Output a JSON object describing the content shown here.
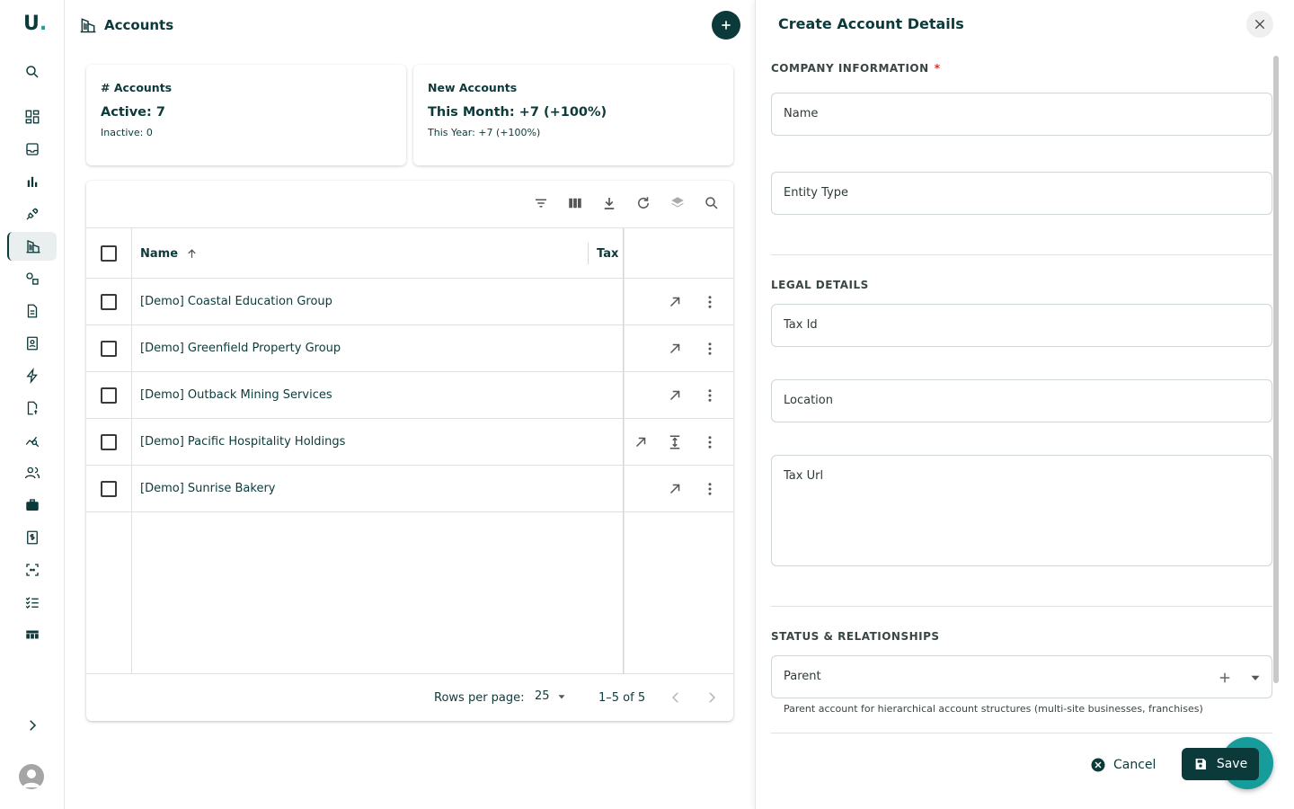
{
  "app": {
    "logo_text": "U",
    "logo_dot": "."
  },
  "rail": {
    "items": [
      {
        "icon": "search-icon"
      },
      {
        "icon": "dashboard-icon"
      },
      {
        "icon": "inbox-icon"
      },
      {
        "icon": "bar-chart-icon"
      },
      {
        "icon": "plug-icon"
      },
      {
        "icon": "building-icon",
        "active": true
      },
      {
        "icon": "shapes-icon"
      },
      {
        "icon": "document-icon"
      },
      {
        "icon": "contacts-book-icon"
      },
      {
        "icon": "lightning-icon"
      },
      {
        "icon": "invoice-icon"
      },
      {
        "icon": "analytics-icon"
      },
      {
        "icon": "people-icon"
      },
      {
        "icon": "briefcase-icon"
      },
      {
        "icon": "receipt-dollar-icon"
      },
      {
        "icon": "scan-icon"
      },
      {
        "icon": "checklist-icon"
      },
      {
        "icon": "table-icon"
      }
    ],
    "expand_icon": "chevron-right-icon",
    "avatar_icon": "avatar-icon"
  },
  "header": {
    "title": "Accounts"
  },
  "stats": {
    "accounts": {
      "title": "# Accounts",
      "main": "Active: 7",
      "sub": "Inactive: 0"
    },
    "new_accounts": {
      "title": "New Accounts",
      "main": "This Month: +7 (+100%)",
      "sub": "This Year: +7 (+100%)"
    }
  },
  "table": {
    "columns": {
      "name": "Name",
      "tax": "Tax Id"
    },
    "rows": [
      {
        "name": "[Demo] Coastal Education Group"
      },
      {
        "name": "[Demo] Greenfield Property Group"
      },
      {
        "name": "[Demo] Outback Mining Services"
      },
      {
        "name": "[Demo] Pacific Hospitality Holdings",
        "hovered": true
      },
      {
        "name": "[Demo] Sunrise Bakery"
      }
    ],
    "footer": {
      "rows_per_page_label": "Rows per page:",
      "rows_per_page_value": "25",
      "range": "1–5 of 5"
    }
  },
  "drawer": {
    "title": "Create Account Details",
    "sections": {
      "company": "COMPANY INFORMATION",
      "required_mark": "*",
      "legal": "LEGAL DETAILS",
      "status": "STATUS & RELATIONSHIPS"
    },
    "fields": {
      "name": "Name",
      "entity_type": "Entity Type",
      "tax_id": "Tax Id",
      "location": "Location",
      "tax_url": "Tax Url",
      "parent": "Parent"
    },
    "parent_helper": "Parent account for hierarchical account structures (multi-site businesses, franchises)",
    "cancel_label": "Cancel",
    "save_label": "Save"
  },
  "colors": {
    "brand": "#0c3a3a",
    "accent": "#169c9a",
    "required": "#d32f2f"
  }
}
